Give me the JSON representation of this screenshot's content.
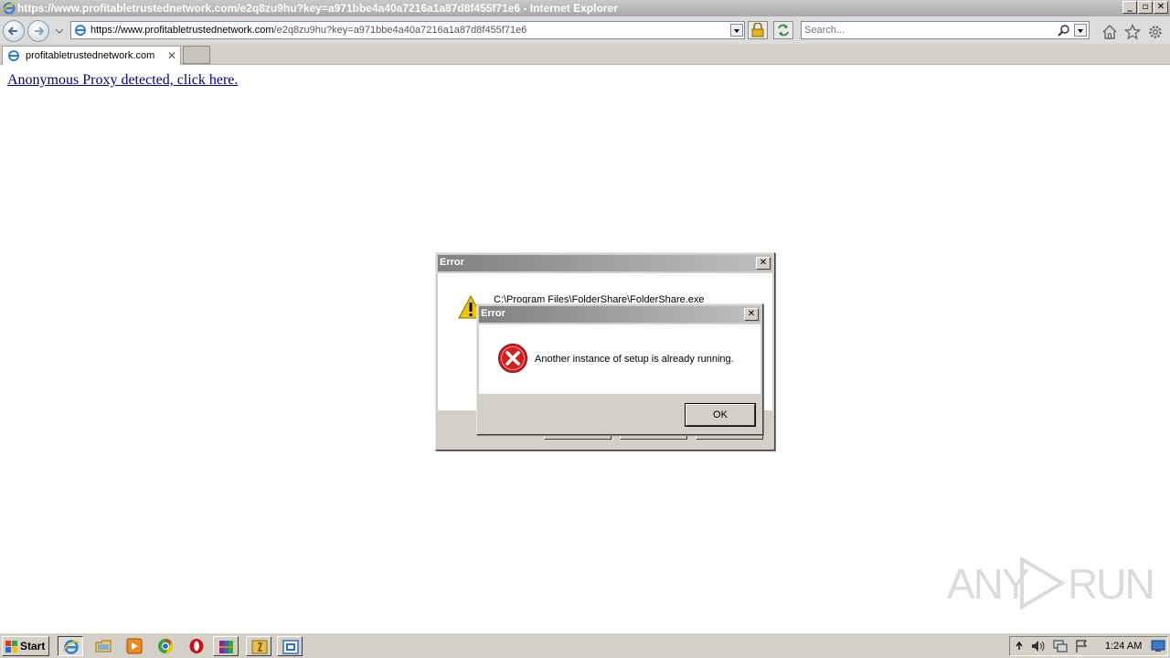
{
  "window": {
    "title": "https://www.profitabletrustednetwork.com/e2q8zu9hu?key=a971bbe4a40a7216a1a87d8f455f71e6 - Internet Explorer",
    "minimize": "_",
    "maximize": "▫",
    "close": "✕"
  },
  "address_bar": {
    "url_domain": "https://www.profitabletrustednetwork.com",
    "url_path": "/e2q8zu9hu?key=a971bbe4a40a7216a1a87d8f455f71e6"
  },
  "search": {
    "placeholder": "Search..."
  },
  "tabs": [
    {
      "label": "profitabletrustednetwork.com",
      "close": "✕"
    }
  ],
  "page": {
    "link_text": "Anonymous Proxy detected, click here."
  },
  "dialog_back": {
    "title": "Error",
    "path": "C:\\Program Files\\FolderShare\\FolderShare.exe",
    "close": "✕"
  },
  "dialog_front": {
    "title": "Error",
    "message": "Another instance of setup is already running.",
    "ok_label": "OK",
    "close": "✕"
  },
  "watermark": {
    "text_left": "ANY",
    "text_right": "RUN"
  },
  "taskbar": {
    "start_label": "Start",
    "clock": "1:24 AM"
  },
  "colors": {
    "link": "#000080",
    "error_icon": "#d32020",
    "warning_icon": "#f2c400"
  }
}
